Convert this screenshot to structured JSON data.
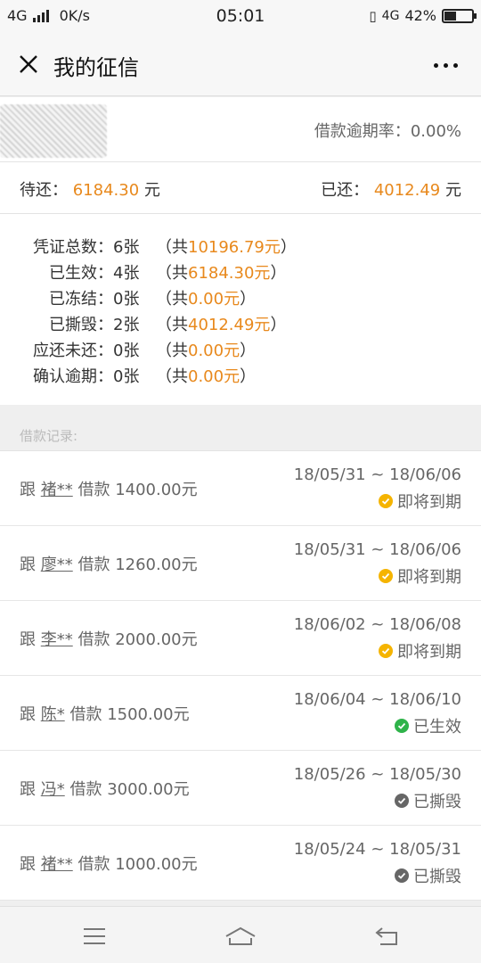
{
  "status_bar": {
    "network": "4G",
    "speed": "0K/s",
    "time": "05:01",
    "network_right": "4G",
    "battery_percent": "42%",
    "battery_level": 0.42
  },
  "header": {
    "title": "我的征信",
    "close_icon": "close-icon",
    "more_icon": "more-icon"
  },
  "summary": {
    "overdue_rate_label": "借款逾期率：",
    "overdue_rate_value": "0.00%",
    "pending_label": "待还：",
    "pending_value": "6184.30",
    "pending_unit": "元",
    "repaid_label": "已还：",
    "repaid_value": "4012.49",
    "repaid_unit": "元"
  },
  "stats": [
    {
      "label": "凭证总数：",
      "count": "6张",
      "open": "（共",
      "amount": "10196.79元",
      "close": "）"
    },
    {
      "label": "已生效：",
      "count": "4张",
      "open": "（共",
      "amount": "6184.30元",
      "close": "）"
    },
    {
      "label": "已冻结：",
      "count": "0张",
      "open": "（共",
      "amount": "0.00元",
      "close": "）"
    },
    {
      "label": "已撕毁：",
      "count": "2张",
      "open": "（共",
      "amount": "4012.49元",
      "close": "）"
    },
    {
      "label": "应还未还：",
      "count": "0张",
      "open": "（共",
      "amount": "0.00元",
      "close": "）"
    },
    {
      "label": "确认逾期：",
      "count": "0张",
      "open": "（共",
      "amount": "0.00元",
      "close": "）"
    }
  ],
  "records_header": "借款记录:",
  "records": [
    {
      "prefix": "跟",
      "name": "褚**",
      "text": "借款 1400.00元",
      "dates": "18/05/31 ~ 18/06/06",
      "status": "即将到期",
      "status_color": "#f5b400"
    },
    {
      "prefix": "跟",
      "name": "廖**",
      "text": "借款 1260.00元",
      "dates": "18/05/31 ~ 18/06/06",
      "status": "即将到期",
      "status_color": "#f5b400"
    },
    {
      "prefix": "跟",
      "name": "李**",
      "text": "借款 2000.00元",
      "dates": "18/06/02 ~ 18/06/08",
      "status": "即将到期",
      "status_color": "#f5b400"
    },
    {
      "prefix": "跟",
      "name": "陈*",
      "text": "借款 1500.00元",
      "dates": "18/06/04 ~ 18/06/10",
      "status": "已生效",
      "status_color": "#2fb34a"
    },
    {
      "prefix": "跟",
      "name": "冯*",
      "text": "借款 3000.00元",
      "dates": "18/05/26 ~ 18/05/30",
      "status": "已撕毁",
      "status_color": "#666666"
    },
    {
      "prefix": "跟",
      "name": "褚**",
      "text": "借款 1000.00元",
      "dates": "18/05/24 ~ 18/05/31",
      "status": "已撕毁",
      "status_color": "#666666"
    }
  ],
  "colors": {
    "accent_orange": "#e8891d",
    "warning_yellow": "#f5b400",
    "success_green": "#2fb34a",
    "neutral_gray": "#666666"
  }
}
